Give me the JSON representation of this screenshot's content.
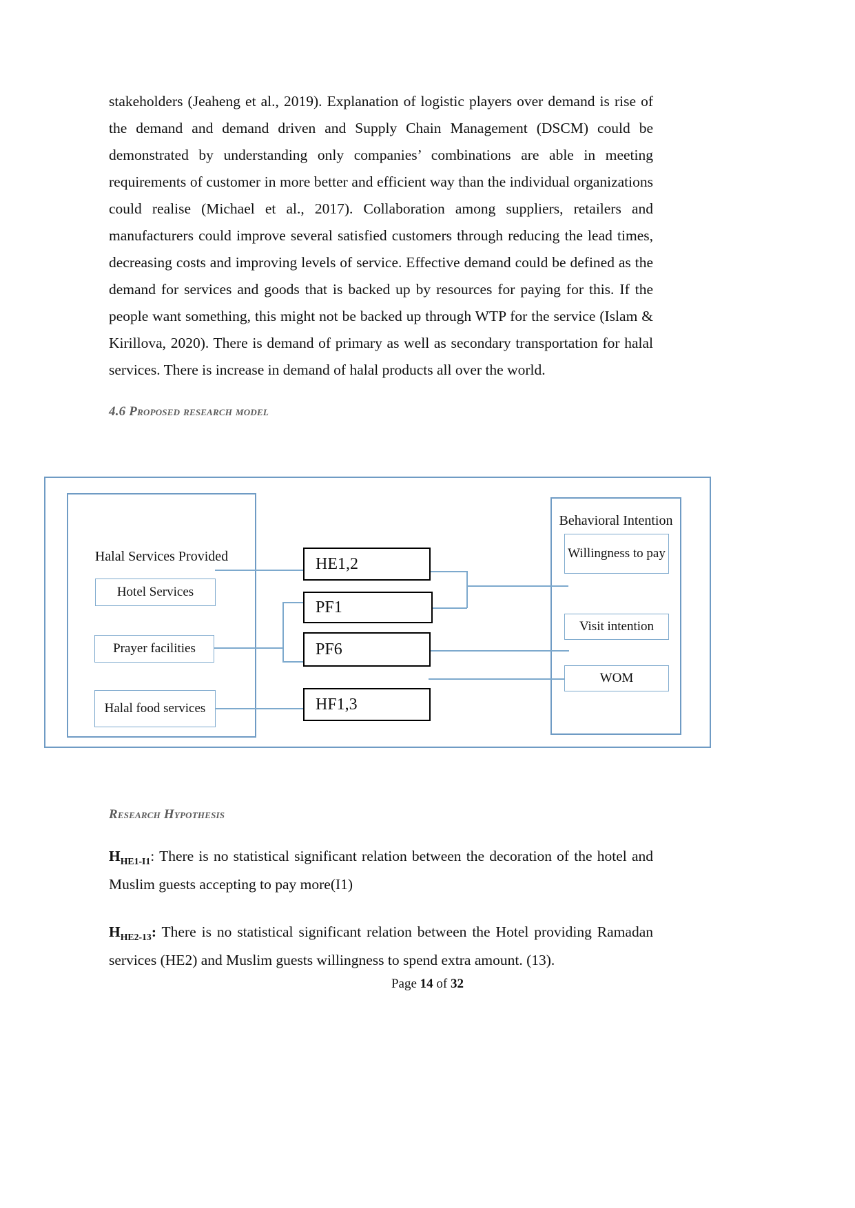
{
  "document": {
    "body_paragraph": "stakeholders (Jeaheng et al., 2019). Explanation of logistic players over demand is rise of the demand and demand driven and Supply Chain Management (DSCM) could be demonstrated by understanding only companies’ combinations are able in meeting requirements of customer in more better and efficient way than the individual organizations could realise (Michael et al., 2017). Collaboration among suppliers, retailers and manufacturers could improve several satisfied customers through reducing the lead times, decreasing costs and improving levels of service. Effective demand could be defined as the demand for services and goods that is backed up by resources for paying for this. If the people want something, this might not be backed up through WTP for the service (Islam & Kirillova, 2020). There is demand of primary as well as secondary transportation for halal services. There is increase in demand of halal products all over the world.",
    "section_heading": "4.6 Proposed research model",
    "hypothesis_heading": "Research Hypothesis",
    "hypothesis_1": {
      "label_main": "H",
      "label_sub": "HE1-I1",
      "text": ": There is no statistical significant relation between the decoration of the hotel and Muslim guests accepting to pay more(I1)"
    },
    "hypothesis_2": {
      "label_main": "H",
      "label_sub": "HE2-13",
      "text": ": There is no statistical significant relation between the Hotel providing Ramadan services (HE2) and Muslim guests willingness to spend extra amount. (13)."
    },
    "footer": {
      "prefix": "Page ",
      "current_page": "14",
      "middle": " of ",
      "total_pages": "32"
    }
  },
  "diagram": {
    "left_group": {
      "title": "Halal Services Provided",
      "boxes": [
        {
          "label": "Hotel Services"
        },
        {
          "label": "Prayer facilities"
        },
        {
          "label": "Halal food services"
        }
      ]
    },
    "middle_boxes": [
      {
        "label": "HE1,2"
      },
      {
        "label": "PF1"
      },
      {
        "label": "PF6"
      },
      {
        "label": "HF1,3"
      }
    ],
    "right_group": {
      "title": "Behavioral Intention",
      "boxes": [
        {
          "label": "Willingness to pay"
        },
        {
          "label": "Visit intention"
        },
        {
          "label": "WOM"
        }
      ]
    },
    "colors": {
      "frame_blue": "#6f9bc4",
      "box_blue": "#7da9cd",
      "box_black": "#000000",
      "connector_blue": "#7da9cd",
      "heading_gray": "#5a5a5a"
    }
  }
}
